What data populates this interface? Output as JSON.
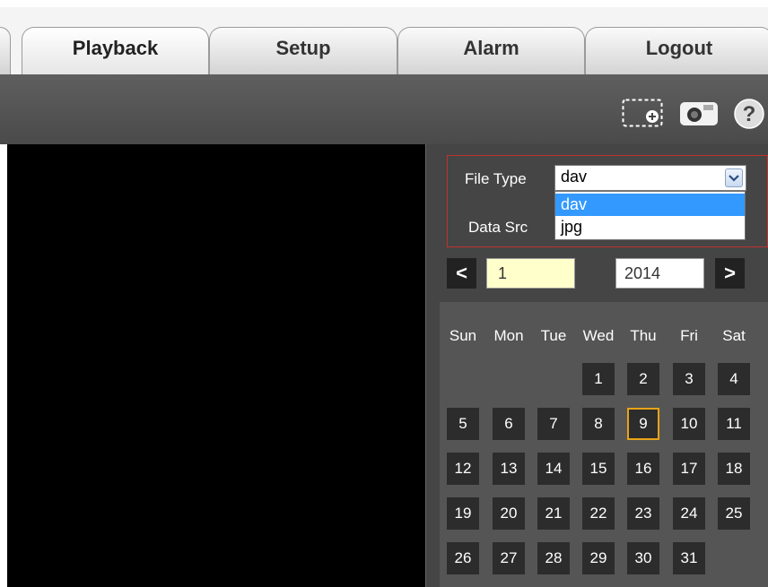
{
  "tabs": [
    {
      "label": "Playback",
      "active": true
    },
    {
      "label": "Setup",
      "active": false
    },
    {
      "label": "Alarm",
      "active": false
    },
    {
      "label": "Logout",
      "active": false
    }
  ],
  "toolbar": {
    "icons": [
      "add-window-icon",
      "snapshot-camera-icon",
      "help-icon"
    ]
  },
  "filter": {
    "file_type_label": "File Type",
    "file_type_value": "dav",
    "file_type_options": [
      "dav",
      "jpg"
    ],
    "data_src_label": "Data Src"
  },
  "calendar": {
    "prev_label": "<",
    "next_label": ">",
    "month": "1",
    "year": "2014",
    "weekdays": [
      "Sun",
      "Mon",
      "Tue",
      "Wed",
      "Thu",
      "Fri",
      "Sat"
    ],
    "days": [
      "1",
      "2",
      "3",
      "4",
      "5",
      "6",
      "7",
      "8",
      "9",
      "10",
      "11",
      "12",
      "13",
      "14",
      "15",
      "16",
      "17",
      "18",
      "19",
      "20",
      "21",
      "22",
      "23",
      "24",
      "25",
      "26",
      "27",
      "28",
      "29",
      "30",
      "31"
    ],
    "today": "9"
  },
  "colors": {
    "highlight_border": "#c0312f",
    "today_border": "#e8a317",
    "selected_option": "#3399ff",
    "month_bg": "#ffffcc"
  }
}
